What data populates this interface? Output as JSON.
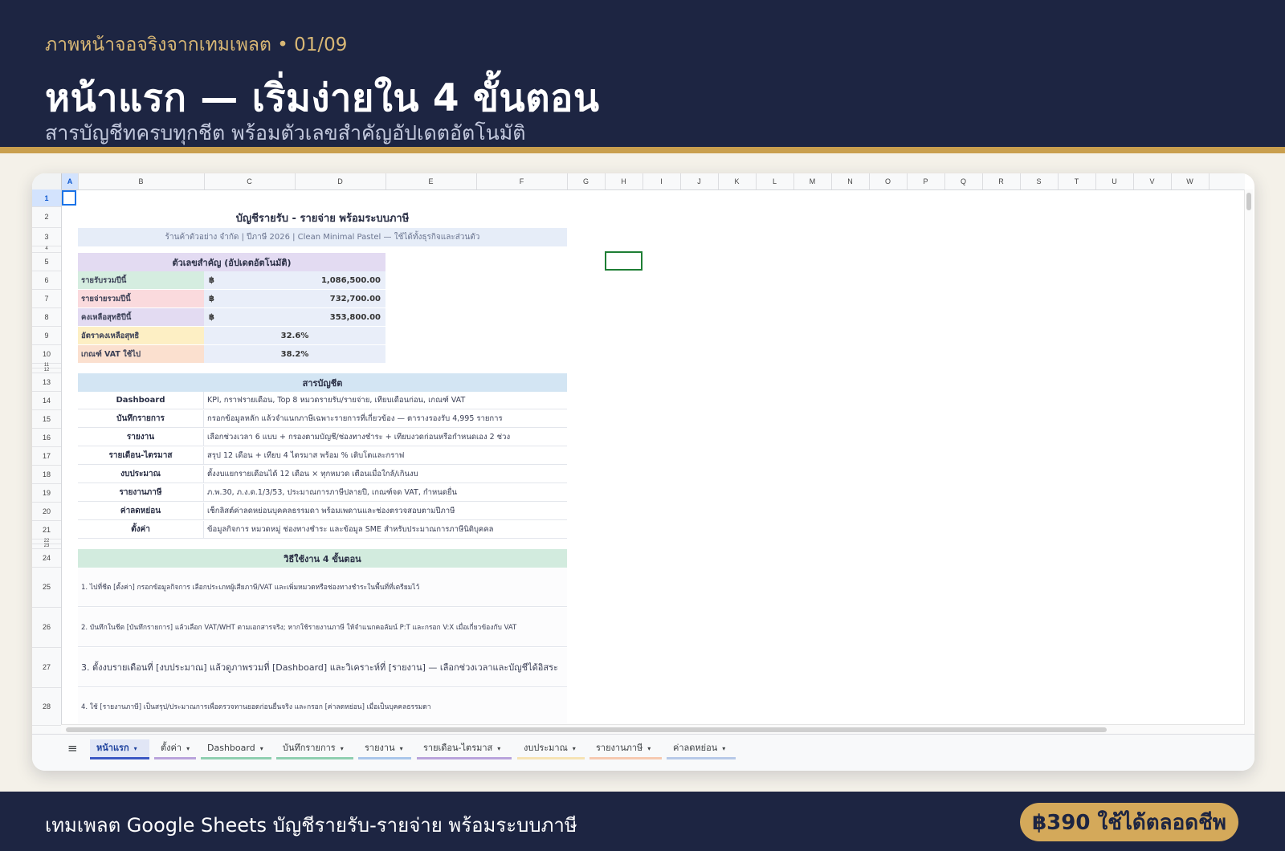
{
  "header": {
    "eyebrow": "ภาพหน้าจอจริงจากเทมเพลต  •  01/09",
    "title": "หน้าแรก — เริ่มง่ายใน 4 ขั้นตอน",
    "subtitle": "สารบัญชีทครบทุกชีต พร้อมตัวเลขสำคัญอัปเดตอัตโนมัติ"
  },
  "columns": [
    "A",
    "B",
    "C",
    "D",
    "E",
    "F",
    "G",
    "H",
    "I",
    "J",
    "K",
    "L",
    "M",
    "N",
    "O",
    "P",
    "Q",
    "R",
    "S",
    "T",
    "U",
    "V",
    "W"
  ],
  "rows": [
    "1",
    "2",
    "3",
    "4",
    "5",
    "6",
    "7",
    "8",
    "9",
    "10",
    "11",
    "12",
    "13",
    "14",
    "15",
    "16",
    "17",
    "18",
    "19",
    "20",
    "21",
    "22",
    "23",
    "24",
    "25",
    "26",
    "27",
    "28"
  ],
  "sheet": {
    "title": "บัญชีรายรับ - รายจ่าย พร้อมระบบภาษี",
    "subtitle": "ร้านค้าตัวอย่าง จำกัด  |  ปีภาษี 2026  |  Clean Minimal Pastel — ใช้ได้ทั้งธุรกิจและส่วนตัว",
    "kpi": {
      "header": "ตัวเลขสำคัญ (อัปเดตอัตโนมัติ)",
      "currency": "฿",
      "rows": [
        {
          "label": "รายรับรวมปีนี้",
          "value": "1,086,500.00",
          "color": "#d5ede0"
        },
        {
          "label": "รายจ่ายรวมปีนี้",
          "value": "732,700.00",
          "color": "#fadadd"
        },
        {
          "label": "คงเหลือสุทธิปีนี้",
          "value": "353,800.00",
          "color": "#e3dbf2"
        },
        {
          "label": "อัตราคงเหลือสุทธิ",
          "value": "32.6%",
          "color": "#fdefc4"
        },
        {
          "label": "เกณฑ์ VAT ใช้ไป",
          "value": "38.2%",
          "color": "#fbe0cf"
        }
      ]
    },
    "toc": {
      "header": "สารบัญชีต",
      "rows": [
        {
          "name": "Dashboard",
          "desc": "KPI, กราฟรายเดือน, Top 8 หมวดรายรับ/รายจ่าย, เทียบเดือนก่อน, เกณฑ์ VAT"
        },
        {
          "name": "บันทึกรายการ",
          "desc": "กรอกข้อมูลหลัก แล้วจำแนกภาษีเฉพาะรายการที่เกี่ยวข้อง — ตารางรองรับ 4,995 รายการ"
        },
        {
          "name": "รายงาน",
          "desc": "เลือกช่วงเวลา 6 แบบ + กรองตามบัญชี/ช่องทางชำระ + เทียบงวดก่อนหรือกำหนดเอง 2 ช่วง"
        },
        {
          "name": "รายเดือน-ไตรมาส",
          "desc": "สรุป 12 เดือน + เทียบ 4 ไตรมาส พร้อม % เติบโตและกราฟ"
        },
        {
          "name": "งบประมาณ",
          "desc": "ตั้งงบแยกรายเดือนได้ 12 เดือน × ทุกหมวด เตือนเมื่อใกล้/เกินงบ"
        },
        {
          "name": "รายงานภาษี",
          "desc": "ภ.พ.30, ภ.ง.ด.1/3/53, ประมาณการภาษีปลายปี, เกณฑ์จด VAT, กำหนดยื่น"
        },
        {
          "name": "ค่าลดหย่อน",
          "desc": "เช็กลิสต์ค่าลดหย่อนบุคคลธรรมดา พร้อมเพดานและช่องตรวจสอบตามปีภาษี"
        },
        {
          "name": "ตั้งค่า",
          "desc": "ข้อมูลกิจการ หมวดหมู่ ช่องทางชำระ และข้อมูล SME สำหรับประมาณการภาษีนิติบุคคล"
        }
      ]
    },
    "steps": {
      "header": "วิธีใช้งาน 4 ขั้นตอน",
      "items": [
        "1. ไปที่ชีต [ตั้งค่า] กรอกข้อมูลกิจการ เลือกประเภทผู้เสียภาษี/VAT และเพิ่มหมวดหรือช่องทางชำระในพื้นที่ที่เตรียมไว้",
        "2. บันทึกในชีต [บันทึกรายการ] แล้วเลือก VAT/WHT ตามเอกสารจริง; หากใช้รายงานภาษี ให้จำแนกคอลัมน์ P:T และกรอก V:X เมื่อเกี่ยวข้องกับ VAT",
        "3. ตั้งงบรายเดือนที่ [งบประมาณ] แล้วดูภาพรวมที่ [Dashboard] และวิเคราะห์ที่ [รายงาน] — เลือกช่วงเวลาและบัญชีได้อิสระ",
        "4. ใช้ [รายงานภาษี] เป็นสรุป/ประมาณการเพื่อตรวจทานยอดก่อนยื่นจริง และกรอก [ค่าลดหย่อน] เมื่อเป็นบุคคลธรรมดา"
      ]
    }
  },
  "tabs": [
    {
      "label": "หน้าแรก",
      "color": "#3b57c4",
      "active": true
    },
    {
      "label": "ตั้งค่า",
      "color": "#b9a3dc"
    },
    {
      "label": "Dashboard",
      "color": "#8fcfb0"
    },
    {
      "label": "บันทึกรายการ",
      "color": "#8fcfb0"
    },
    {
      "label": "รายงาน",
      "color": "#a9c6ea"
    },
    {
      "label": "รายเดือน-ไตรมาส",
      "color": "#b9a3dc"
    },
    {
      "label": "งบประมาณ",
      "color": "#f6e3b4"
    },
    {
      "label": "รายงานภาษี",
      "color": "#f6c9b0"
    },
    {
      "label": "ค่าลดหย่อน",
      "color": "#b7c9e8"
    }
  ],
  "footer": {
    "text": "เทมเพลต Google Sheets บัญชีรายรับ-รายจ่าย พร้อมระบบภาษี",
    "price": "฿390 ใช้ได้ตลอดชีพ"
  },
  "colors": {
    "navy": "#1d2542",
    "gold": "#c99f4e",
    "kpi_header": "#e3dbf2",
    "toc_header": "#d3e5f3",
    "steps_header": "#d2ebde",
    "subtitle_band": "#e6edf8"
  }
}
